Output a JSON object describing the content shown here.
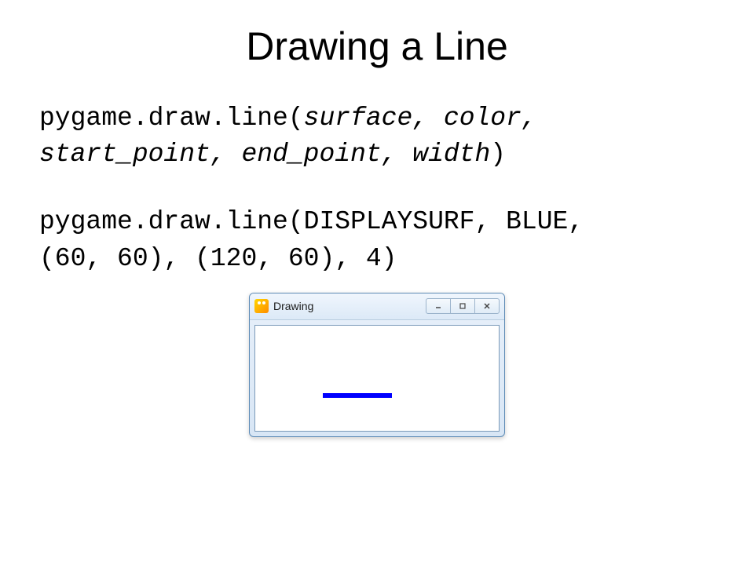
{
  "title": "Drawing a Line",
  "code_signature": {
    "prefix": "pygame.draw.line(",
    "params": "surface, color, start_point, end_point, width",
    "suffix": ")"
  },
  "code_example": {
    "line1": "pygame.draw.line(DISPLAYSURF, BLUE,",
    "line2": "(60, 60), (120, 60), 4)"
  },
  "window": {
    "title": "Drawing"
  },
  "chart_data": {
    "type": "line",
    "title": "Drawing",
    "description": "Pygame window showing a horizontal blue line drawn with pygame.draw.line",
    "line": {
      "color": "#0000ff",
      "start_point": [
        60,
        60
      ],
      "end_point": [
        120,
        60
      ],
      "width": 4
    }
  }
}
